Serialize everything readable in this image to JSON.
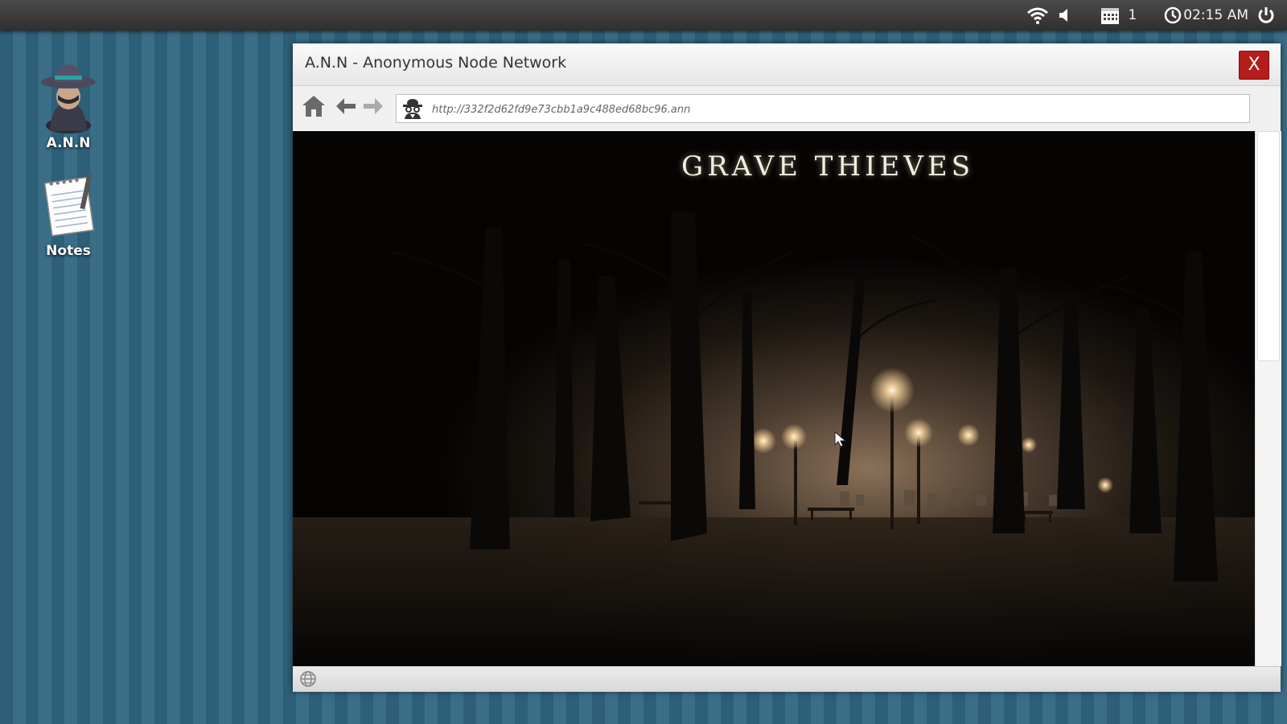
{
  "taskbar": {
    "notification_count": "1",
    "time": "02:15 AM",
    "icons": [
      "wifi-icon",
      "volume-icon",
      "calendar-icon",
      "clock-icon",
      "power-icon"
    ]
  },
  "desktop": {
    "icons": [
      {
        "label": "A.N.N",
        "icon": "spy-agent-icon"
      },
      {
        "label": "Notes",
        "icon": "notepad-icon"
      }
    ]
  },
  "window": {
    "title": "A.N.N - Anonymous Node Network",
    "close_label": "X",
    "address": "http://332f2d62fd9e73cbb1a9c488ed68bc96.ann"
  },
  "page": {
    "heading": "GRAVE THIEVES"
  },
  "colors": {
    "close_button": "#b61c1c",
    "desktop_stripe_dark": "#2e5f78",
    "desktop_stripe_light": "#3a6e87",
    "page_background": "#050403"
  }
}
